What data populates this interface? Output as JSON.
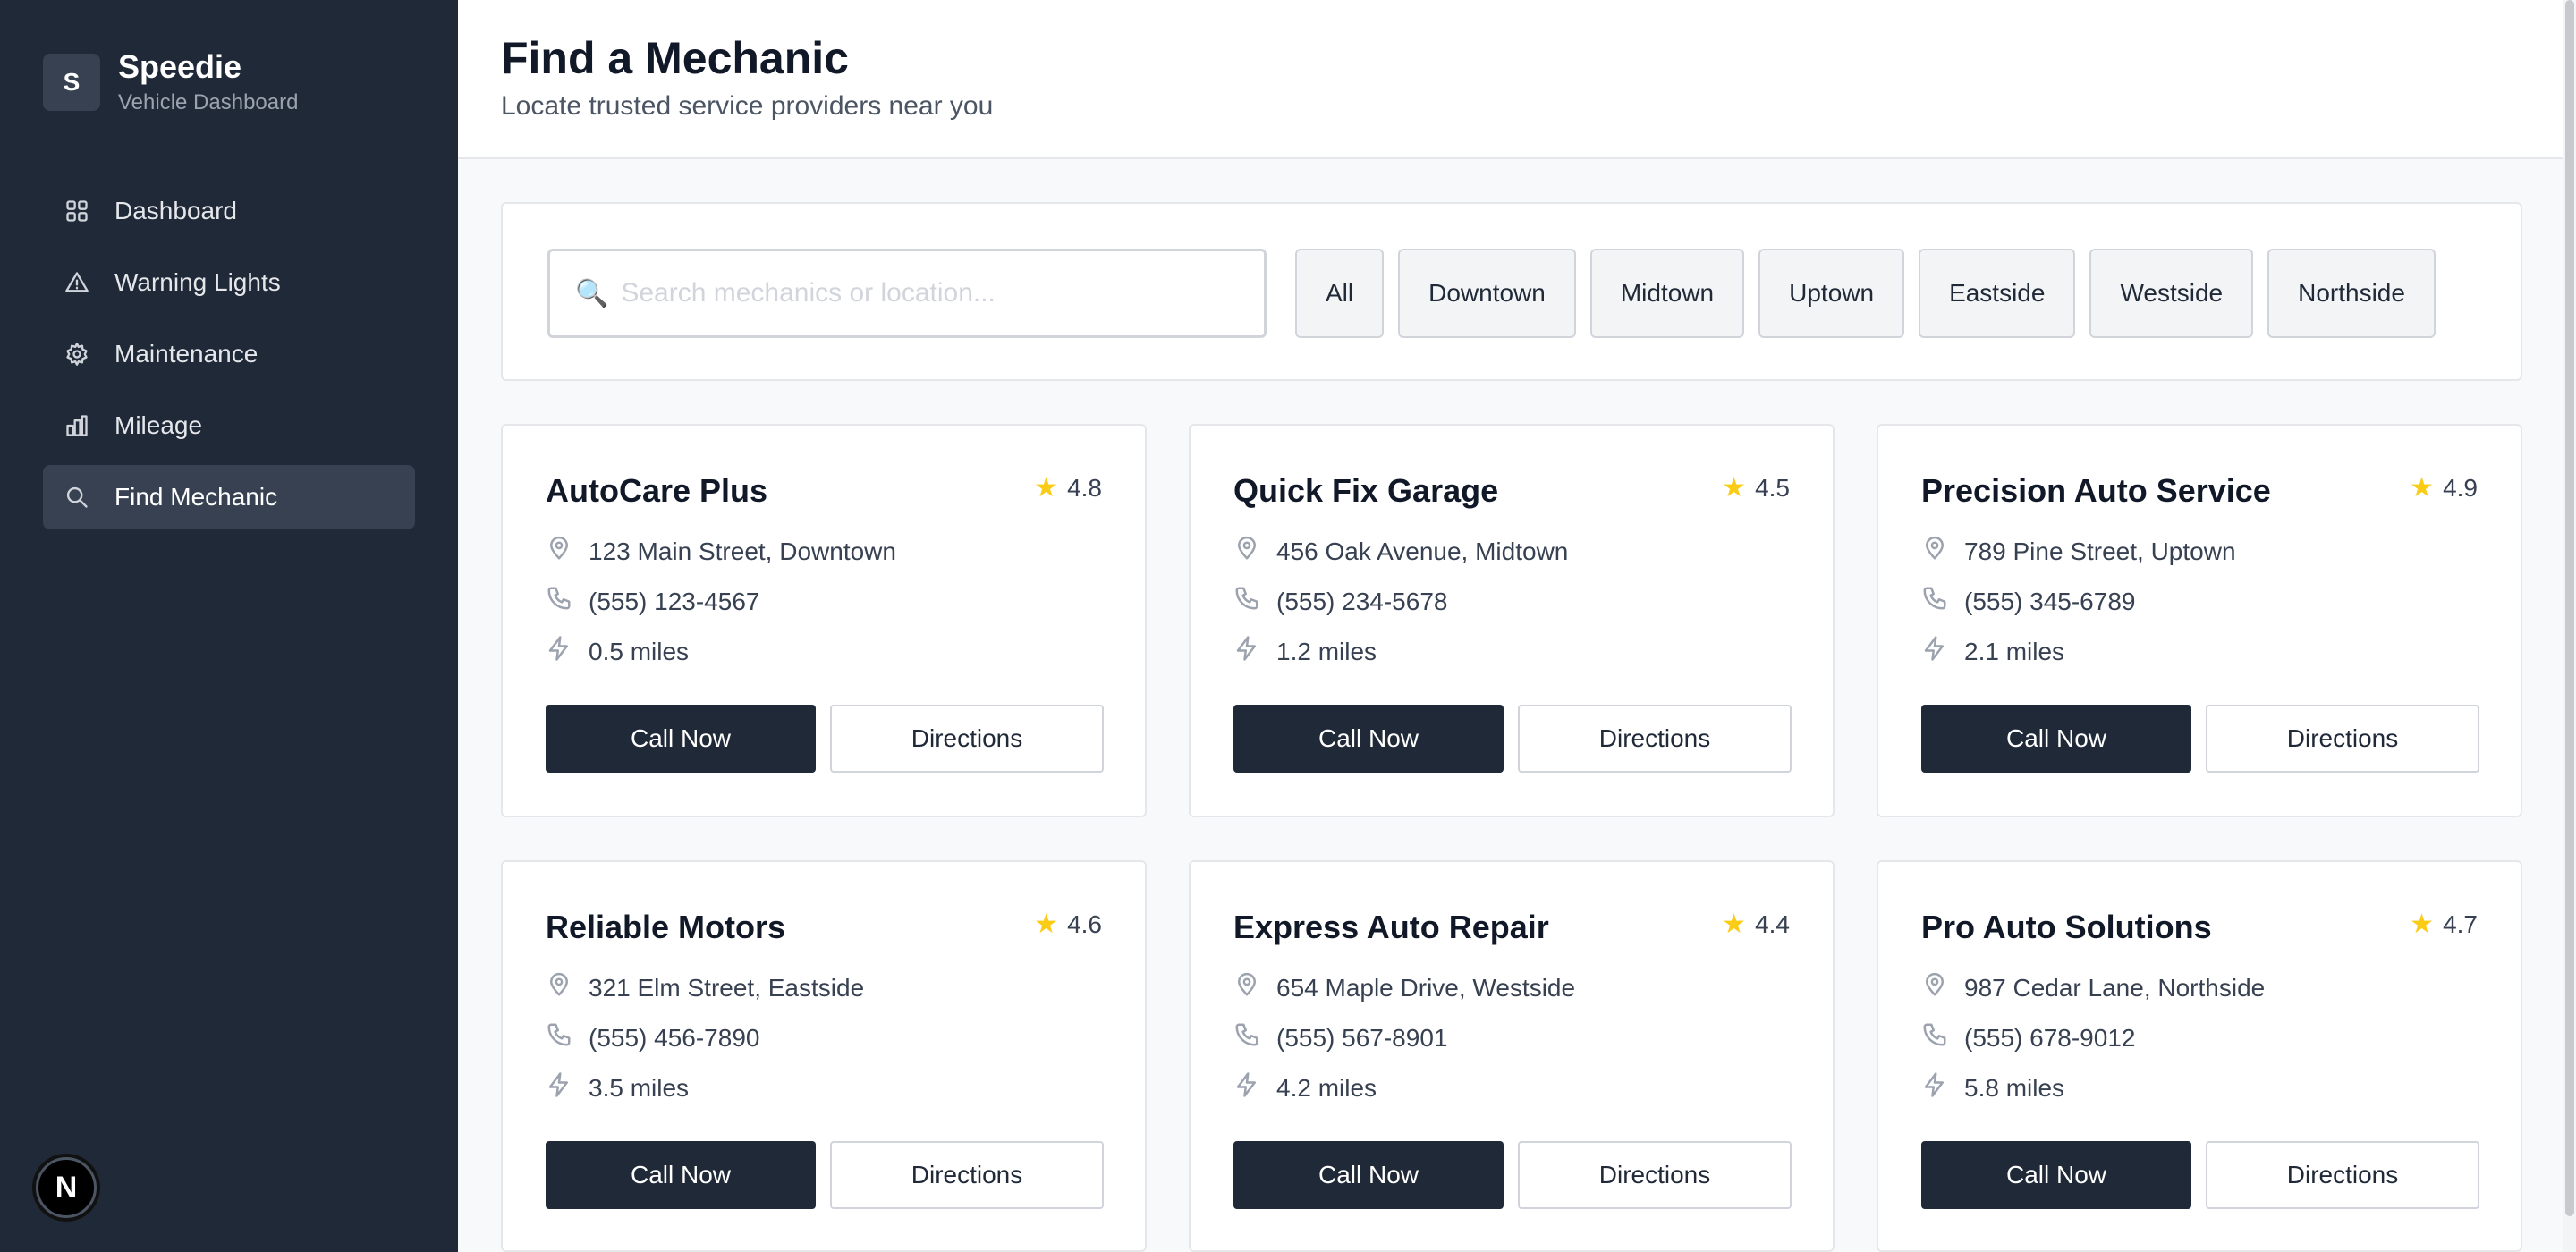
{
  "brand": {
    "initial": "S",
    "name": "Speedie",
    "subtitle": "Vehicle Dashboard"
  },
  "nav": [
    {
      "label": "Dashboard",
      "icon": "grid-icon",
      "active": false
    },
    {
      "label": "Warning Lights",
      "icon": "warning-triangle-icon",
      "active": false
    },
    {
      "label": "Maintenance",
      "icon": "gear-icon",
      "active": false
    },
    {
      "label": "Mileage",
      "icon": "bar-chart-icon",
      "active": false
    },
    {
      "label": "Find Mechanic",
      "icon": "search-icon",
      "active": true
    }
  ],
  "next_badge": "N",
  "header": {
    "title": "Find a Mechanic",
    "subtitle": "Locate trusted service providers near you"
  },
  "search": {
    "placeholder": "Search mechanics or location...",
    "icon": "🔍"
  },
  "filters": [
    "All",
    "Downtown",
    "Midtown",
    "Uptown",
    "Eastside",
    "Westside",
    "Northside"
  ],
  "buttons": {
    "call": "Call Now",
    "directions": "Directions"
  },
  "mechanics": [
    {
      "name": "AutoCare Plus",
      "rating": "4.8",
      "address": "123 Main Street, Downtown",
      "phone": "(555) 123-4567",
      "distance": "0.5 miles"
    },
    {
      "name": "Quick Fix Garage",
      "rating": "4.5",
      "address": "456 Oak Avenue, Midtown",
      "phone": "(555) 234-5678",
      "distance": "1.2 miles"
    },
    {
      "name": "Precision Auto Service",
      "rating": "4.9",
      "address": "789 Pine Street, Uptown",
      "phone": "(555) 345-6789",
      "distance": "2.1 miles"
    },
    {
      "name": "Reliable Motors",
      "rating": "4.6",
      "address": "321 Elm Street, Eastside",
      "phone": "(555) 456-7890",
      "distance": "3.5 miles"
    },
    {
      "name": "Express Auto Repair",
      "rating": "4.4",
      "address": "654 Maple Drive, Westside",
      "phone": "(555) 567-8901",
      "distance": "4.2 miles"
    },
    {
      "name": "Pro Auto Solutions",
      "rating": "4.7",
      "address": "987 Cedar Lane, Northside",
      "phone": "(555) 678-9012",
      "distance": "5.8 miles"
    }
  ],
  "colors": {
    "sidebar": "#1f2937",
    "star": "#facc15",
    "primary_button": "#1f2937"
  }
}
